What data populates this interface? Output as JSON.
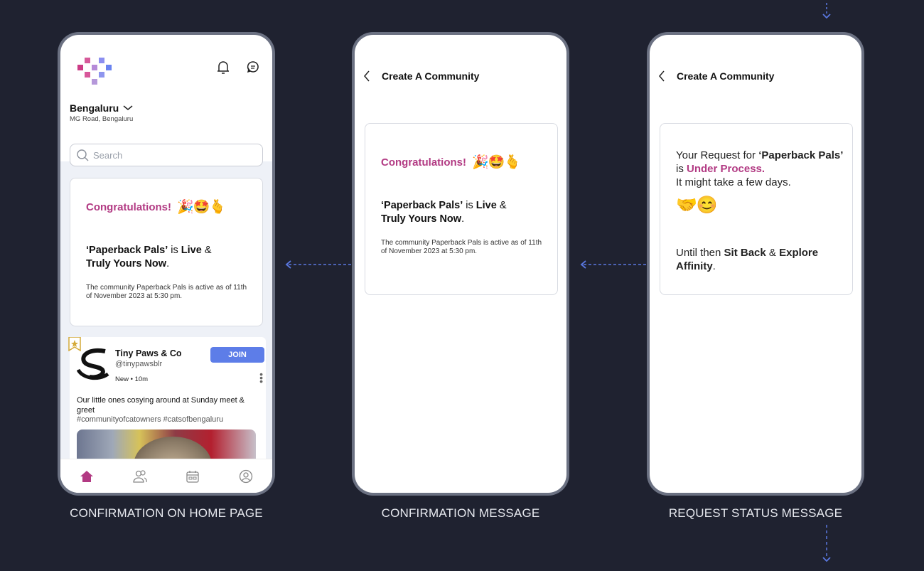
{
  "colors": {
    "background": "#1f2230",
    "accent_pink": "#b23a83",
    "join_blue": "#5d7de8",
    "arrow_blue": "#5a78e0"
  },
  "screens": [
    {
      "caption": "CONFIRMATION ON HOME PAGE",
      "city": "Bengaluru",
      "area": "MG Road, Bengaluru",
      "search_placeholder": "Search",
      "congrats": "Congratulations!",
      "emojis": "🎉🤩🫰",
      "headline_name": "‘Paperback Pals’",
      "headline_is": " is ",
      "headline_live": "Live",
      "headline_amp": " & ",
      "headline_truly": "Truly Yours Now",
      "headline_dot": ".",
      "note": "The community Paperback Pals is active as of 11th of November 2023 at 5:30 pm.",
      "post": {
        "name": "Tiny Paws & Co",
        "handle": "@tinypawsblr",
        "meta": "New • 10m",
        "join_label": "JOIN",
        "text": "Our little ones cosying around at Sunday meet & greet",
        "tags": "#communityofcatowners #catsofbengaluru"
      },
      "nav": [
        "home",
        "community",
        "calendar",
        "profile"
      ]
    },
    {
      "caption": "CONFIRMATION MESSAGE",
      "title": "Create A Community",
      "congrats": "Congratulations!",
      "emojis": "🎉🤩🫰",
      "headline_name": "‘Paperback Pals’",
      "headline_is": " is ",
      "headline_live": "Live",
      "headline_amp": " & ",
      "headline_truly": "Truly Yours Now",
      "headline_dot": ".",
      "note": "The community Paperback Pals is active as of 11th of November 2023 at 5:30 pm."
    },
    {
      "caption": "REQUEST STATUS MESSAGE",
      "title": "Create A Community",
      "req_prefix": "Your Request for ",
      "req_name": "‘Paperback Pals’",
      "req_is": " is ",
      "req_status": "Under Process.",
      "req_days": "It might take a few days.",
      "emojis": "🤝😊",
      "until": "Until then ",
      "sit_back": "Sit Back",
      "amp": " & ",
      "explore": "Explore Affinity",
      "dot": "."
    }
  ]
}
